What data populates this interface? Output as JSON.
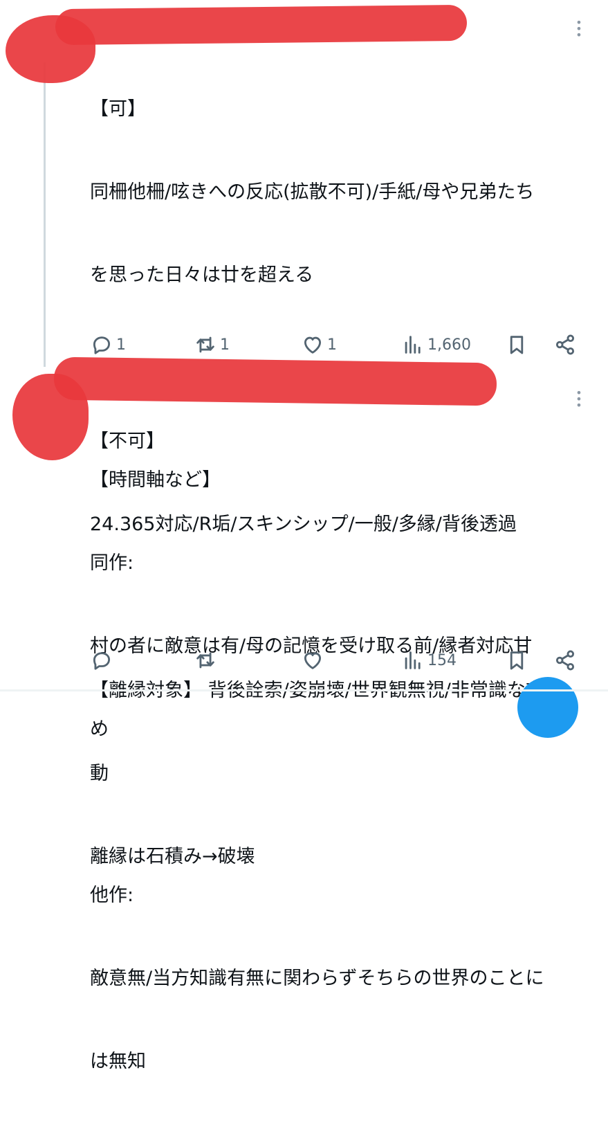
{
  "tweets": [
    {
      "lines": [
        "【可】",
        "同柵他柵/呟きへの反応(拡散不可)/手紙/母や兄弟たち",
        "を思った日々は廿を超える",
        "",
        "【不可】",
        "24.365対応/R垢/スキンシップ/一般/多縁/背後透過",
        "",
        "【離縁対象】 背後詮索/姿崩壊/世界観無視/非常識な言",
        "動",
        "離縁は石積み→破壊"
      ],
      "actions": {
        "reply_count": "1",
        "retweet_count": "1",
        "like_count": "1",
        "views_count": "1,660"
      }
    },
    {
      "lines": [
        "【時間軸など】",
        "同作:",
        "村の者に敵意は有/母の記憶を受け取る前/縁者対応甘",
        "め",
        "",
        "他作:",
        "敵意無/当方知識有無に関わらずそちらの世界のことに",
        "は無知"
      ],
      "actions": {
        "reply_count": "",
        "retweet_count": "",
        "like_count": "",
        "views_count": "154"
      }
    }
  ],
  "icons": {
    "reply": "reply-icon",
    "retweet": "retweet-icon",
    "like": "like-icon",
    "views": "views-icon",
    "bookmark": "bookmark-icon",
    "share": "share-icon",
    "more": "more-vertical-icon"
  },
  "colors": {
    "redaction": "#e8383c",
    "icon": "#536471",
    "text": "#0f1419",
    "thread_line": "#cfd9de",
    "fab": "#1d9bf0"
  }
}
